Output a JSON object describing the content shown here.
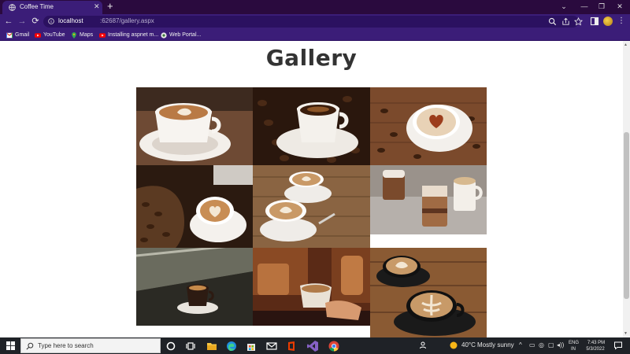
{
  "browser": {
    "tab": {
      "title": "Coffee Time"
    },
    "url": {
      "host": "localhost",
      "path": ":62687/gallery.aspx"
    },
    "bookmarks": [
      {
        "label": "Gmail",
        "icon": "gmail-icon"
      },
      {
        "label": "YouTube",
        "icon": "youtube-icon"
      },
      {
        "label": "Maps",
        "icon": "maps-icon"
      },
      {
        "label": "Installing aspnet m...",
        "icon": "youtube-icon"
      },
      {
        "label": "Web Portal...",
        "icon": "portal-icon"
      }
    ],
    "colors": {
      "chrome": "#3b1d78",
      "tabstrip": "#2a0a3e",
      "omnibox": "#2b1160"
    }
  },
  "page": {
    "title": "Gallery",
    "photos": [
      {
        "name": "latte-art-cup-on-saucer",
        "icon": "coffee-photo"
      },
      {
        "name": "black-coffee-with-beans",
        "icon": "coffee-photo"
      },
      {
        "name": "heart-latte-with-beans",
        "icon": "coffee-photo"
      },
      {
        "name": "beans-sack-and-heart-latte",
        "icon": "coffee-photo"
      },
      {
        "name": "two-latte-cups-on-wood",
        "icon": "coffee-photo"
      },
      {
        "name": "iced-coffee-glasses",
        "icon": "coffee-photo"
      },
      {
        "name": "espresso-on-counter",
        "icon": "coffee-photo"
      },
      {
        "name": "espresso-machine-pour",
        "icon": "coffee-photo"
      },
      {
        "name": "two-black-cups-latte-art",
        "icon": "coffee-photo"
      }
    ]
  },
  "taskbar": {
    "search_placeholder": "Type here to search",
    "weather": {
      "temp": "40°C",
      "condition": "Mostly sunny"
    },
    "language": {
      "line1": "ENG",
      "line2": "IN"
    },
    "clock": {
      "time": "7:43 PM",
      "date": "5/3/2022"
    },
    "colors": {
      "background": "#1f2227",
      "accent": "#8fb3e8"
    }
  }
}
